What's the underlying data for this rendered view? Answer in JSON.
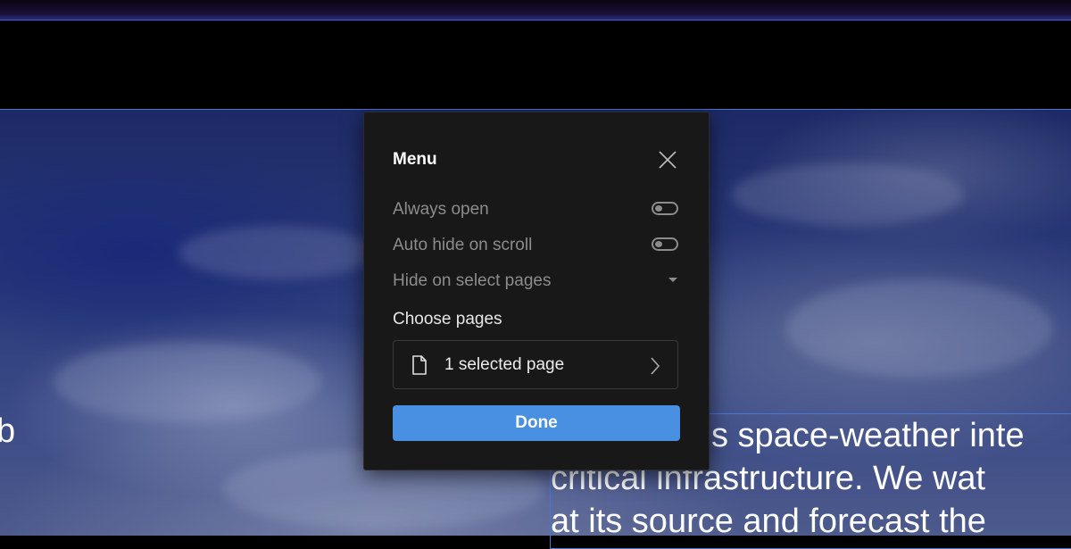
{
  "hero": {
    "left_text": "b",
    "right_lines": [
      "s space-weather inte",
      "critical infrastructure. We wat",
      "at its source and forecast the"
    ]
  },
  "menu": {
    "title": "Menu",
    "always_open_label": "Always open",
    "always_open_on": false,
    "auto_hide_label": "Auto hide on scroll",
    "auto_hide_on": false,
    "hide_select_label": "Hide on select pages",
    "choose_label": "Choose pages",
    "selected_pages": "1 selected page",
    "done_label": "Done"
  },
  "colors": {
    "accent": "#4a90e2",
    "panel_bg": "#181818",
    "selection_outline": "#4a77d6"
  },
  "icons": {
    "close": "close-icon",
    "toggle": "toggle-icon",
    "dropdown": "caret-down-icon",
    "page": "document-icon",
    "chevron": "chevron-right-icon"
  }
}
